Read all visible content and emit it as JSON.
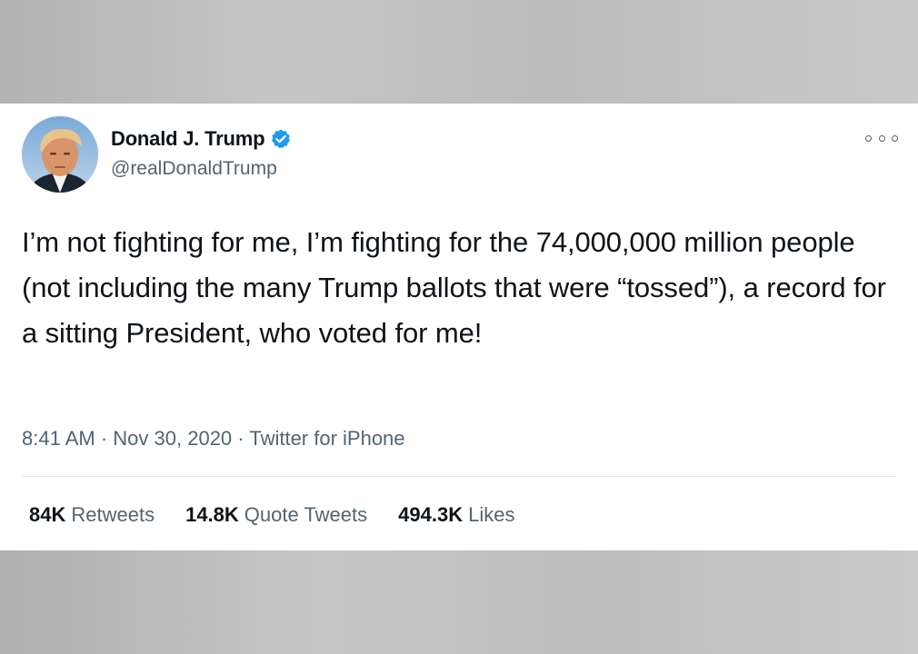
{
  "tweet": {
    "author": {
      "display_name": "Donald J. Trump",
      "handle": "@realDonaldTrump",
      "verified": true,
      "verified_color": "#1d9bf0"
    },
    "text": "I’m not fighting for me, I’m fighting for the 74,000,000 million people (not including the many Trump ballots that were “tossed”), a record for a sitting President, who voted for me!",
    "time": "8:41 AM",
    "date": "Nov 30, 2020",
    "source": "Twitter for iPhone",
    "stats": [
      {
        "count": "84K",
        "label": "Retweets"
      },
      {
        "count": "14.8K",
        "label": "Quote Tweets"
      },
      {
        "count": "494.3K",
        "label": "Likes"
      }
    ],
    "more_icon": "more-options-icon"
  }
}
